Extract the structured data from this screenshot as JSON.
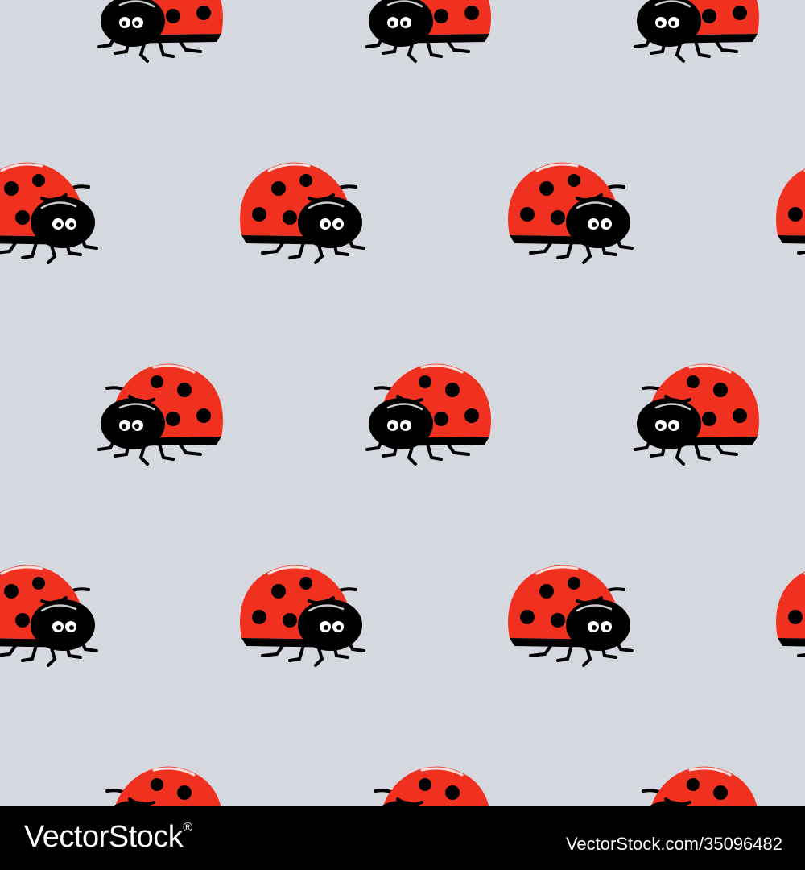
{
  "pattern": {
    "background_color": "#d6d8e0",
    "shell_color": "#f0311f",
    "body_color": "#000000",
    "eye_color": "#ffffff",
    "ladybug_icon": "ladybug-icon"
  },
  "footer": {
    "brand": "VectorStock",
    "registered_mark": "®",
    "stock_id": "VectorStock.com/35096482"
  }
}
